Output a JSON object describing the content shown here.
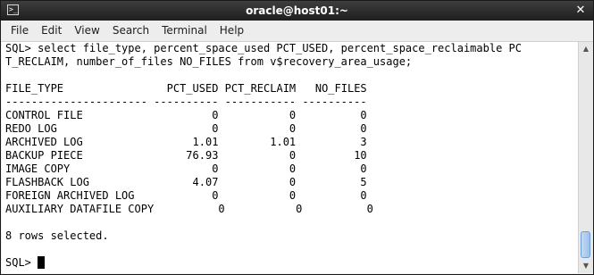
{
  "window": {
    "title": "oracle@host01:~",
    "terminal_icon": "terminal-icon",
    "close_icon": "close-icon",
    "close_glyph": "✕"
  },
  "menu": [
    "File",
    "Edit",
    "View",
    "Search",
    "Terminal",
    "Help"
  ],
  "terminal": {
    "command_lines": [
      "SQL> select file_type, percent_space_used PCT_USED, percent_space_reclaimable PC",
      "T_RECLAIM, number_of_files NO_FILES from v$recovery_area_usage;"
    ],
    "header": {
      "file_type": "FILE_TYPE",
      "pct_used": "PCT_USED",
      "pct_reclaim": "PCT_RECLAIM",
      "no_files": "NO_FILES"
    },
    "separator": "---------------------- ---------- ----------- ----------",
    "rows": [
      {
        "file_type": "CONTROL FILE",
        "pct_used": "0",
        "pct_reclaim": "0",
        "no_files": "0"
      },
      {
        "file_type": "REDO LOG",
        "pct_used": "0",
        "pct_reclaim": "0",
        "no_files": "0"
      },
      {
        "file_type": "ARCHIVED LOG",
        "pct_used": "1.01",
        "pct_reclaim": "1.01",
        "no_files": "3"
      },
      {
        "file_type": "BACKUP PIECE",
        "pct_used": "76.93",
        "pct_reclaim": "0",
        "no_files": "10"
      },
      {
        "file_type": "IMAGE COPY",
        "pct_used": "0",
        "pct_reclaim": "0",
        "no_files": "0"
      },
      {
        "file_type": "FLASHBACK LOG",
        "pct_used": "4.07",
        "pct_reclaim": "0",
        "no_files": "5"
      },
      {
        "file_type": "FOREIGN ARCHIVED LOG",
        "pct_used": "0",
        "pct_reclaim": "0",
        "no_files": "0"
      },
      {
        "file_type": "AUXILIARY DATAFILE COPY",
        "pct_used": "0",
        "pct_reclaim": "0",
        "no_files": "0"
      }
    ],
    "footer": "8 rows selected.",
    "prompt": "SQL> "
  },
  "scrollbar": {
    "up_glyph": "▲",
    "down_glyph": "▼"
  }
}
